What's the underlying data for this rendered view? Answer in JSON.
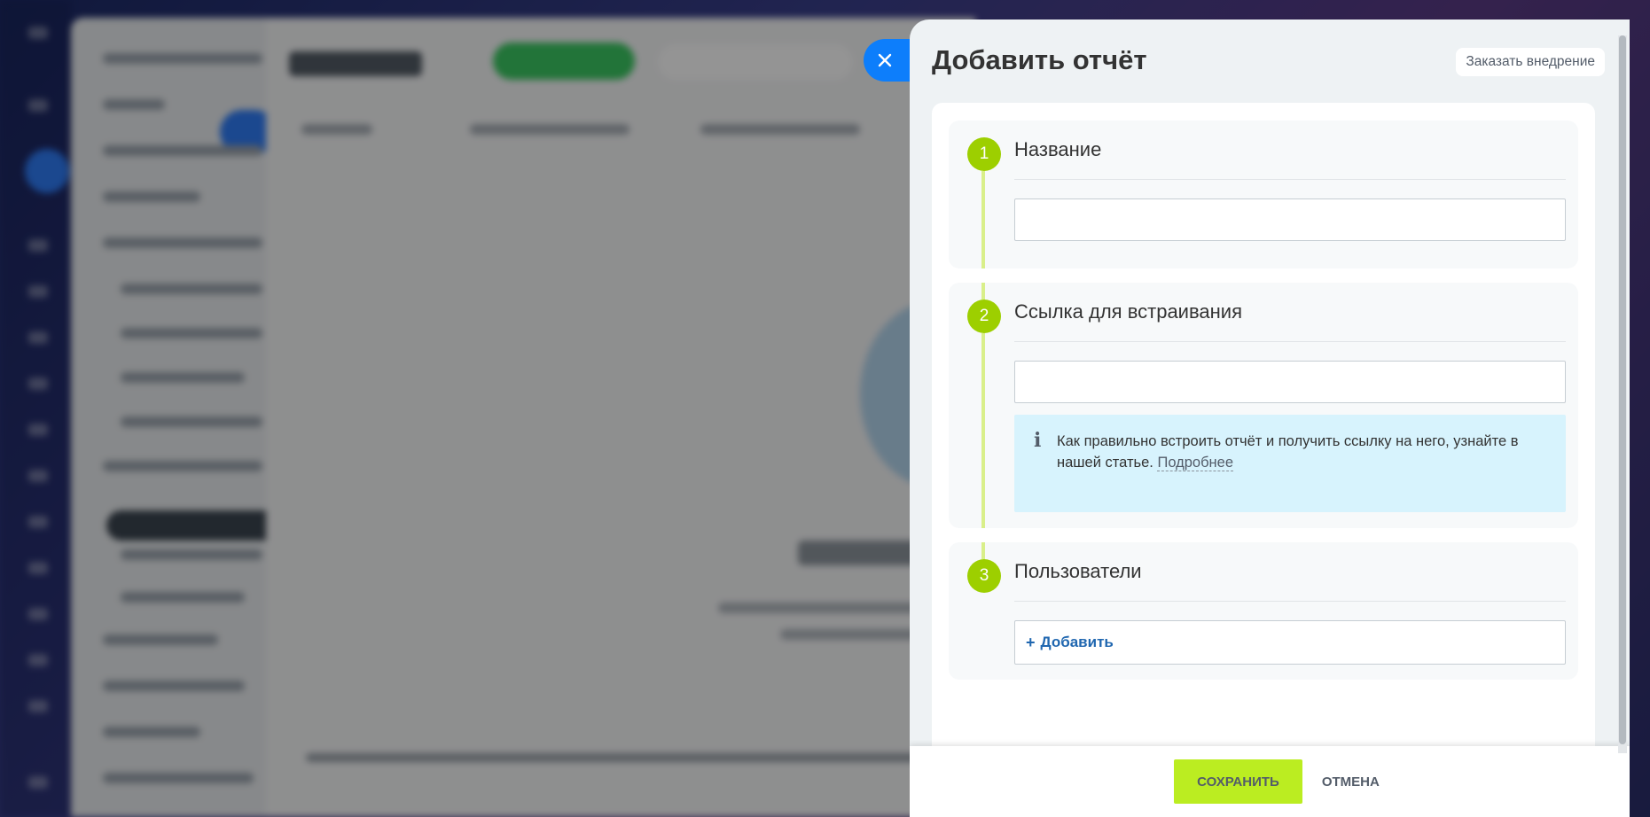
{
  "slider": {
    "title": "Добавить отчёт",
    "order_button": "Заказать внедрение",
    "close_icon": "close-icon"
  },
  "sections": [
    {
      "number": "1",
      "title": "Название",
      "input_value": ""
    },
    {
      "number": "2",
      "title": "Ссылка для встраивания",
      "input_value": "",
      "info": {
        "icon": "info-icon",
        "text": "Как правильно встроить отчёт и получить ссылку на него, узнайте в нашей статье.",
        "link": "Подробнее"
      }
    },
    {
      "number": "3",
      "title": "Пользователи",
      "add_plus": "+",
      "add_label": "Добавить"
    }
  ],
  "footer": {
    "save_label": "СОХРАНИТЬ",
    "cancel_label": "ОТМЕНА"
  },
  "colors": {
    "accent_green": "#bbed21",
    "step_green": "#9dcf00",
    "close_blue": "#0d7efb",
    "info_bg": "#d7f3fd",
    "link_blue": "#2067b0"
  }
}
